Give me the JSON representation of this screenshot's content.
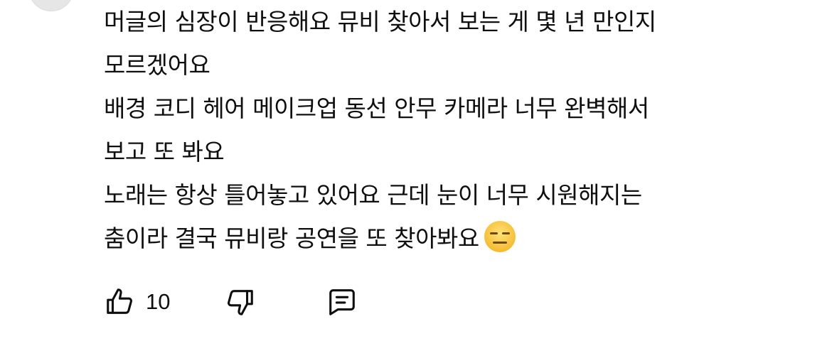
{
  "comment": {
    "lines": [
      "머글의 심장이 반응해요 뮤비 찾아서 보는 게 몇 년 만인지",
      "모르겠어요",
      "배경 코디 헤어 메이크업 동선 안무 카메라 너무 완벽해서",
      "보고 또 봐요",
      "노래는 항상 틀어놓고 있어요 근데 눈이 너무 시원해지는",
      "춤이라 결국 뮤비랑 공연을 또 찾아봐요"
    ],
    "trailing_emoji": "expressionless-face-emoji"
  },
  "actions": {
    "like_icon": "thumbs-up-icon",
    "like_count": "10",
    "dislike_icon": "thumbs-down-icon",
    "reply_icon": "comment-reply-icon"
  },
  "colors": {
    "text": "#0f0f0f",
    "background": "#ffffff",
    "emoji_face": "#f7c63a"
  }
}
